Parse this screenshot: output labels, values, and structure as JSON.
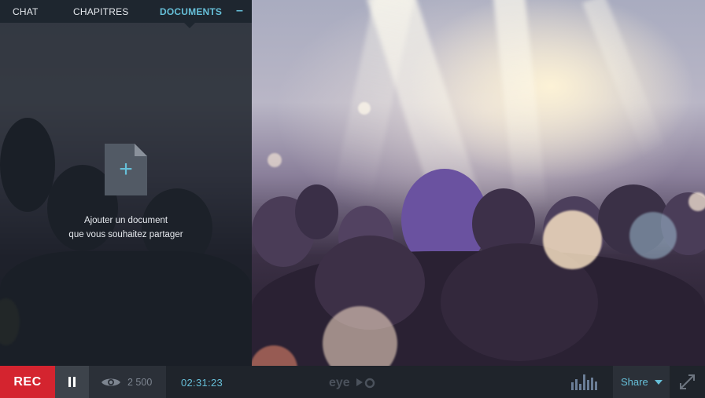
{
  "tabs": [
    {
      "label": "CHAT",
      "active": false
    },
    {
      "label": "CHAPITRES",
      "active": false
    },
    {
      "label": "DOCUMENTS",
      "active": true
    }
  ],
  "collapse_label": "–",
  "documents": {
    "add_line1": "Ajouter un document",
    "add_line2": "que vous souhaitez partager",
    "add_icon": "add-document-icon"
  },
  "bottom_bar": {
    "rec_label": "REC",
    "views_count": "2 500",
    "timer": "02:31:23",
    "logo_text": "eyeo",
    "share_label": "Share"
  },
  "colors": {
    "accent": "#66bfd8",
    "rec": "#d4242f",
    "bar_bg": "#1f242b"
  }
}
